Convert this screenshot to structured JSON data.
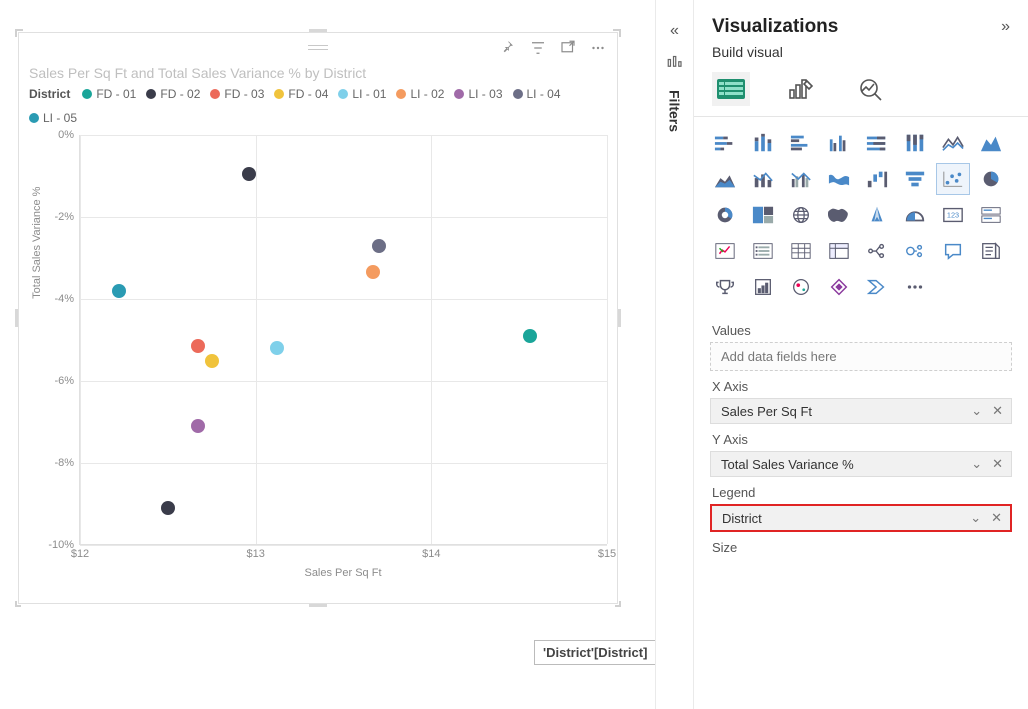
{
  "visual": {
    "title": "Sales Per Sq Ft and Total Sales Variance % by District",
    "legend_title": "District",
    "legend_items": [
      {
        "label": "FD - 01",
        "color": "#1aa599"
      },
      {
        "label": "FD - 02",
        "color": "#3a3c4a"
      },
      {
        "label": "FD - 03",
        "color": "#ec6a5a"
      },
      {
        "label": "FD - 04",
        "color": "#f0c33c"
      },
      {
        "label": "LI - 01",
        "color": "#7fd0ea"
      },
      {
        "label": "LI - 02",
        "color": "#f49b5f"
      },
      {
        "label": "LI - 03",
        "color": "#a06aa8"
      },
      {
        "label": "LI - 04",
        "color": "#6c6e86"
      },
      {
        "label": "LI - 05",
        "color": "#2a9bb3"
      }
    ],
    "xaxis_label": "Sales Per Sq Ft",
    "yaxis_label": "Total Sales Variance %",
    "xticks": [
      "$12",
      "$13",
      "$14",
      "$15"
    ],
    "yticks": [
      "0%",
      "-2%",
      "-4%",
      "-6%",
      "-8%",
      "-10%"
    ]
  },
  "chart_data": {
    "type": "scatter",
    "xlabel": "Sales Per Sq Ft",
    "ylabel": "Total Sales Variance %",
    "xlim": [
      12,
      15
    ],
    "ylim": [
      -10,
      0
    ],
    "series": [
      {
        "name": "FD - 01",
        "color": "#1aa599",
        "points": [
          {
            "x": 14.56,
            "y": -4.9
          }
        ]
      },
      {
        "name": "FD - 02",
        "color": "#3a3c4a",
        "points": [
          {
            "x": 12.96,
            "y": -0.95
          },
          {
            "x": 12.5,
            "y": -9.1
          }
        ]
      },
      {
        "name": "FD - 03",
        "color": "#ec6a5a",
        "points": [
          {
            "x": 12.67,
            "y": -5.15
          }
        ]
      },
      {
        "name": "FD - 04",
        "color": "#f0c33c",
        "points": [
          {
            "x": 12.75,
            "y": -5.5
          }
        ]
      },
      {
        "name": "LI - 01",
        "color": "#7fd0ea",
        "points": [
          {
            "x": 13.12,
            "y": -5.2
          }
        ]
      },
      {
        "name": "LI - 02",
        "color": "#f49b5f",
        "points": [
          {
            "x": 13.67,
            "y": -3.35
          }
        ]
      },
      {
        "name": "LI - 03",
        "color": "#a06aa8",
        "points": [
          {
            "x": 12.67,
            "y": -7.1
          }
        ]
      },
      {
        "name": "LI - 04",
        "color": "#6c6e86",
        "points": [
          {
            "x": 13.7,
            "y": -2.7
          }
        ]
      },
      {
        "name": "LI - 05",
        "color": "#2a9bb3",
        "points": [
          {
            "x": 12.22,
            "y": -3.8
          }
        ]
      }
    ]
  },
  "tooltip": "'District'[District]",
  "side_rail": {
    "filters": "Filters"
  },
  "viz_panel": {
    "title": "Visualizations",
    "subtitle": "Build visual",
    "values_label": "Values",
    "values_placeholder": "Add data fields here",
    "xaxis_label": "X Axis",
    "xaxis_field": "Sales Per Sq Ft",
    "yaxis_label": "Y Axis",
    "yaxis_field": "Total Sales Variance %",
    "legend_label": "Legend",
    "legend_field": "District",
    "size_label": "Size"
  }
}
